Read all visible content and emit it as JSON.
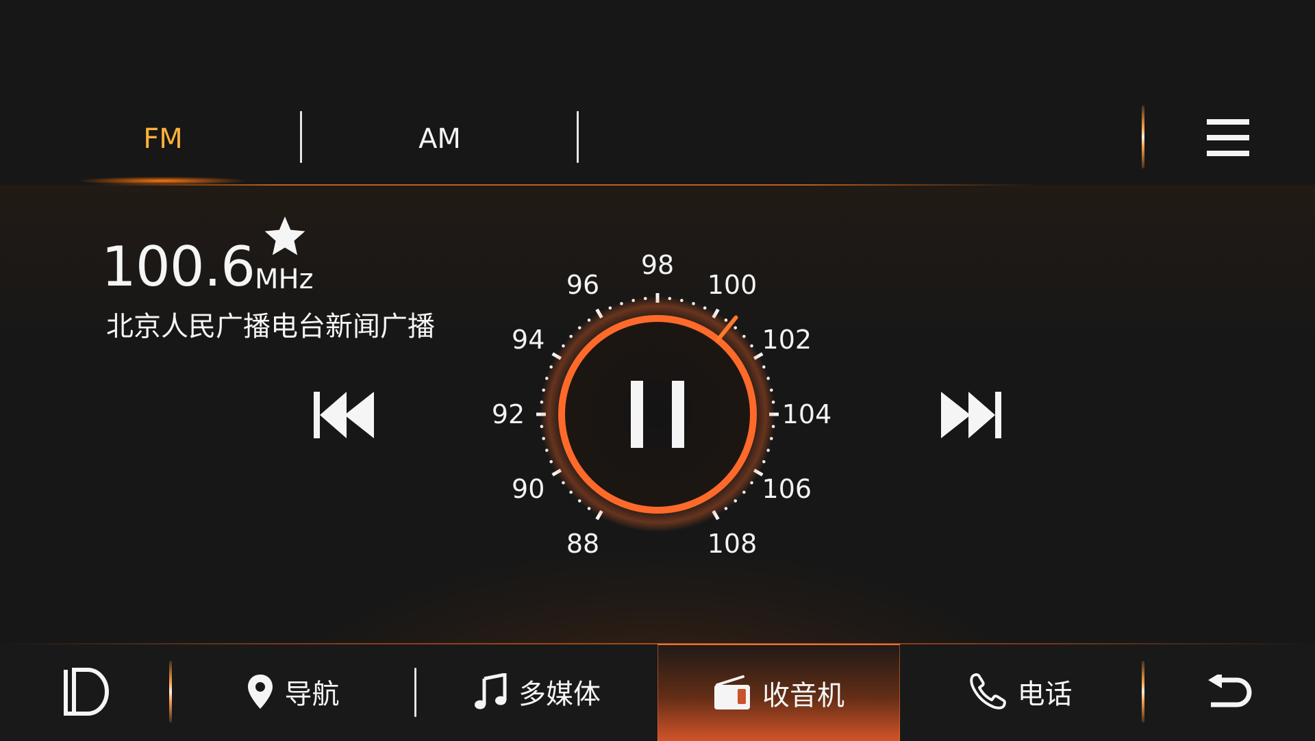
{
  "tabs": [
    {
      "label": "FM",
      "active": true
    },
    {
      "label": "AM",
      "active": false
    }
  ],
  "station": {
    "frequency": "100.6",
    "unit": "MHz",
    "name": "北京人民广播电台新闻广播",
    "favorite": true
  },
  "dial": {
    "labels": [
      "88",
      "90",
      "92",
      "94",
      "96",
      "98",
      "100",
      "102",
      "104",
      "106",
      "108"
    ],
    "current": 100.6,
    "min": 88,
    "max": 108,
    "state": "playing"
  },
  "nav": [
    {
      "label": "导航",
      "icon": "location-pin-icon"
    },
    {
      "label": "多媒体",
      "icon": "music-note-icon"
    },
    {
      "label": "收音机",
      "icon": "radio-icon",
      "active": true
    },
    {
      "label": "电话",
      "icon": "phone-icon"
    }
  ],
  "colors": {
    "accent": "#ff6a2a",
    "tab_active": "#ffb23a",
    "background": "#171717"
  }
}
